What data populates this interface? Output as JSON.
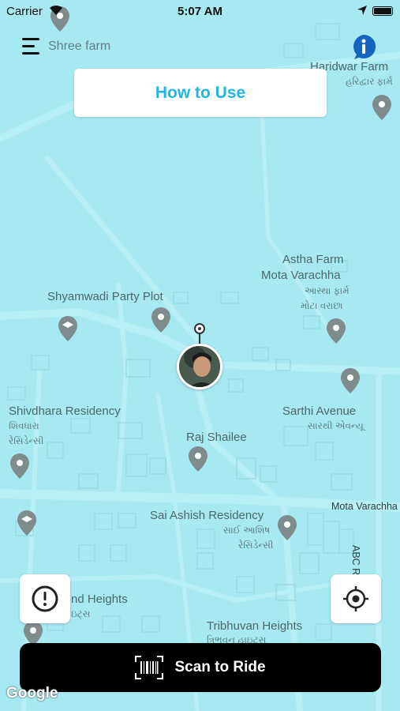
{
  "status_bar": {
    "carrier": "Carrier",
    "time": "5:07 AM"
  },
  "header": {
    "farm_name": "Shree farm"
  },
  "how_to_use": {
    "label": "How to Use"
  },
  "map": {
    "labels": {
      "haridwar_farm": "Haridwar Farm",
      "haridwar_farm_gu": "હરિદ્વાર ફાર્મ",
      "astha_farm": "Astha Farm",
      "mota_varachha": "Mota Varachha",
      "astha_farm_gu": "આસ્થા ફાર્મ",
      "mota_varachha_gu": "મોટા વરાછા",
      "shyamwadi": "Shyamwadi Party Plot",
      "shivdhara": "Shivdhara Residency",
      "shivdhara_gu_1": "શિવધારા",
      "shivdhara_gu_2": "રેસિડેન્સી",
      "sarthi": "Sarthi Avenue",
      "sarthi_gu": "સારથી એવન્યૂ",
      "raj_shailee": "Raj Shailee",
      "sai_ashish": "Sai Ashish Residency",
      "sai_ashish_gu_1": "સાઈ આશિષ",
      "sai_ashish_gu_2": "રેસિડેન્સી",
      "mota_varachha_road": "Mota Varachha",
      "abc_rd": "ABC Rd",
      "heights_partial": "nd Heights",
      "heights_partial_gu": "ઇટ્સ",
      "tribhuvan": "Tribhuvan Heights",
      "tribhuvan_gu": "ત્રિભુવન હાઇટ્સ"
    },
    "attribution": "Google"
  },
  "actions": {
    "scan_to_ride": "Scan to Ride"
  },
  "colors": {
    "map_bg": "#a7e9f2",
    "accent": "#1fb7e6",
    "info": "#1565c0"
  }
}
